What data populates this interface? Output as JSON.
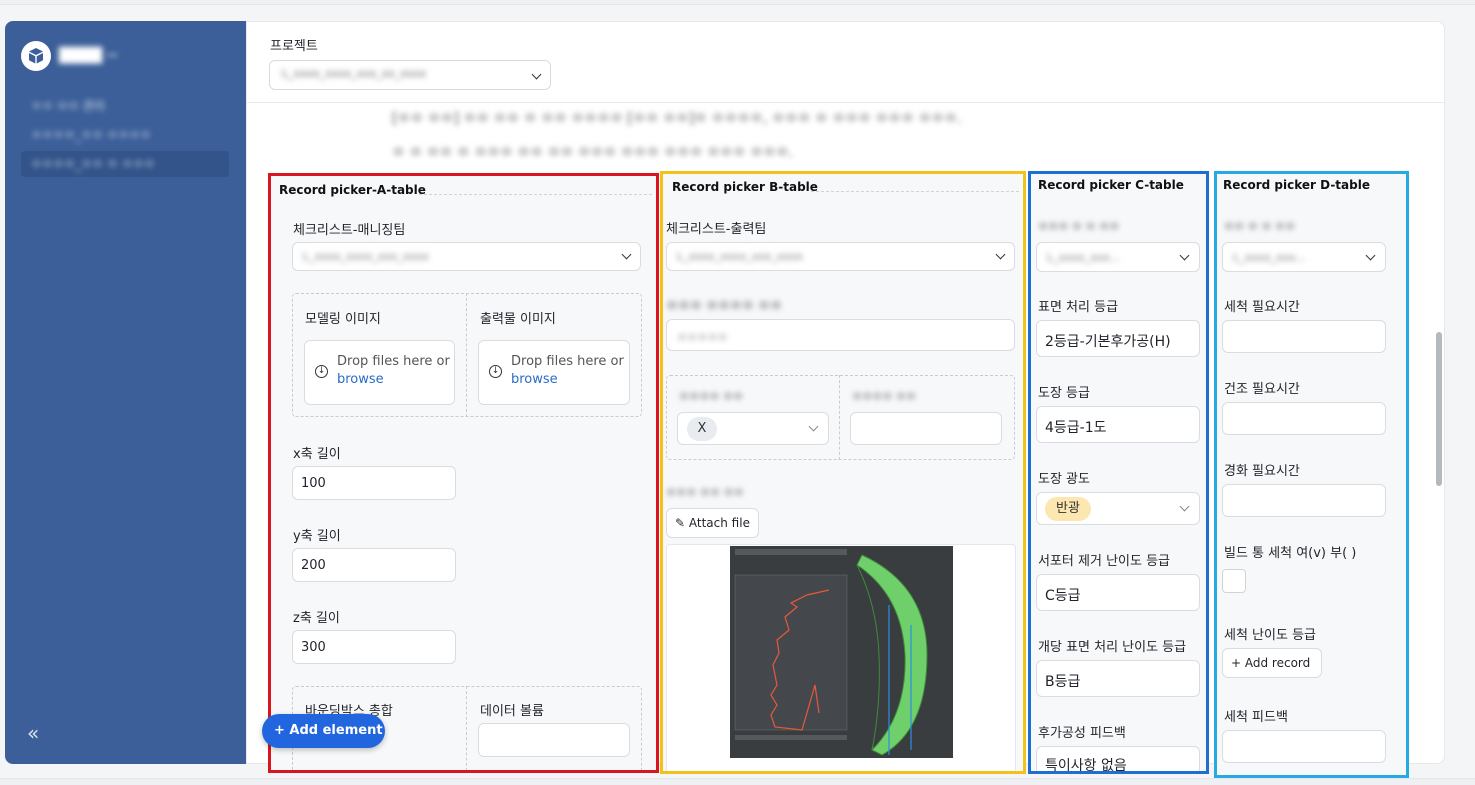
{
  "sidebar": {
    "app_name": "████ ··",
    "items": [
      "ㅇㅇ ㅁㅁ 관리",
      "ㅇㅇㅇㅇ_ㅇㅇ ㅇㅇㅇㅇ",
      "ㅇㅇㅇㅇ_ㅇㅇ ㅇ ㅇㅇㅇ"
    ],
    "collapse_icon": "«"
  },
  "header": {
    "project_label": "프로젝트",
    "project_value": "L_xxxx_xxxx_xxx_xx_xxxx"
  },
  "description": {
    "line1": "[ㅇㅇ ㅇㅇ] ㅇㅇ ㅇㅇ ㅇ ㅇㅇ ㅇㅇㅇㅇ [ㅇㅇ ㅇㅇ]ㅇ ㅇㅇㅇㅇ, ㅇㅇㅇ ㅇ ㅇㅇㅇ ㅇㅇㅇ ㅇㅇㅇ.",
    "line2": "ㅇ ㅇ ㅇㅇ ㅇ ㅇㅇㅇ ㅇㅇ ㅇㅇ ㅇㅇㅇ ㅇㅇㅇ ㅇㅇㅇ ㅇㅇㅇ ㅇㅇㅇ."
  },
  "col_a": {
    "title": "Record picker-A-table",
    "checklist_label": "체크리스트-매니징팀",
    "checklist_value": "L_xxxx_xxxx_xxx_xxxx",
    "modeling_image_label": "모델링 이미지",
    "output_image_label": "출력물 이미지",
    "drop_text": "Drop files here or",
    "browse": "browse",
    "x_label": "x축 길이",
    "x_value": "100",
    "y_label": "y축 길이",
    "y_value": "200",
    "z_label": "z축 길이",
    "z_value": "300",
    "bbox_label": "바운딩박스 총합",
    "volume_label": "데이터 볼륨"
  },
  "col_b": {
    "title": "Record picker B-table",
    "checklist_label": "체크리스트-출력팀",
    "checklist_value": "L_xxxx_xxxx_xxx_xxxx",
    "field2_label": "ㅇㅇㅇ ㅇㅇㅇㅇ ㅇㅇ",
    "field2_value": "ㅇㅇㅇㅇㅇ",
    "sub1_label": "ㅇㅇㅇㅇ ㅇㅇ",
    "sub1_tag": "X",
    "sub2_label": "ㅇㅇㅇㅇ ㅇㅇ",
    "attach_label": "ㅇㅇㅇ ㅇㅇ ㅇㅇ",
    "attach_button": "Attach file"
  },
  "col_c": {
    "title": "Record picker C-table",
    "field1_label": "ㅇㅇㅇ ㅇ ㅇ ㅇㅇ",
    "field1_value": "L_xxxx_xxx...",
    "surface_grade_label": "표면 처리 등급",
    "surface_grade_value": "2등급-기본후가공(H)",
    "paint_grade_label": "도장 등급",
    "paint_grade_value": "4등급-1도",
    "paint_gloss_label": "도장 광도",
    "paint_gloss_value": "반광",
    "support_label": "서포터 제거 난이도 등급",
    "support_value": "C등급",
    "unit_surface_label": "개당 표면 처리 난이도 등급",
    "unit_surface_value": "B등급",
    "feedback_label": "후가공성 피드백",
    "feedback_value": "특이사항 없음"
  },
  "col_d": {
    "title": "Record picker D-table",
    "field1_label": "ㅇㅇ ㅇ ㅇ ㅇㅇ",
    "field1_value": "L_xxxx_xxx...",
    "wash_time_label": "세척 필요시간",
    "dry_time_label": "건조 필요시간",
    "cure_time_label": "경화 필요시간",
    "build_wash_label": "빌드 통 세척 여(v) 부( )",
    "wash_difficulty_label": "세척 난이도 등급",
    "add_record": "+ Add record",
    "wash_feedback_label": "세척 피드백"
  },
  "add_element_button": "+ Add element",
  "colors": {
    "sidebar": "#3c5f99",
    "accent": "#2266df",
    "col_a_border": "#d9161f",
    "col_b_border": "#f1c21b",
    "col_c_border": "#1f6fd1",
    "col_d_border": "#27a9e1"
  }
}
